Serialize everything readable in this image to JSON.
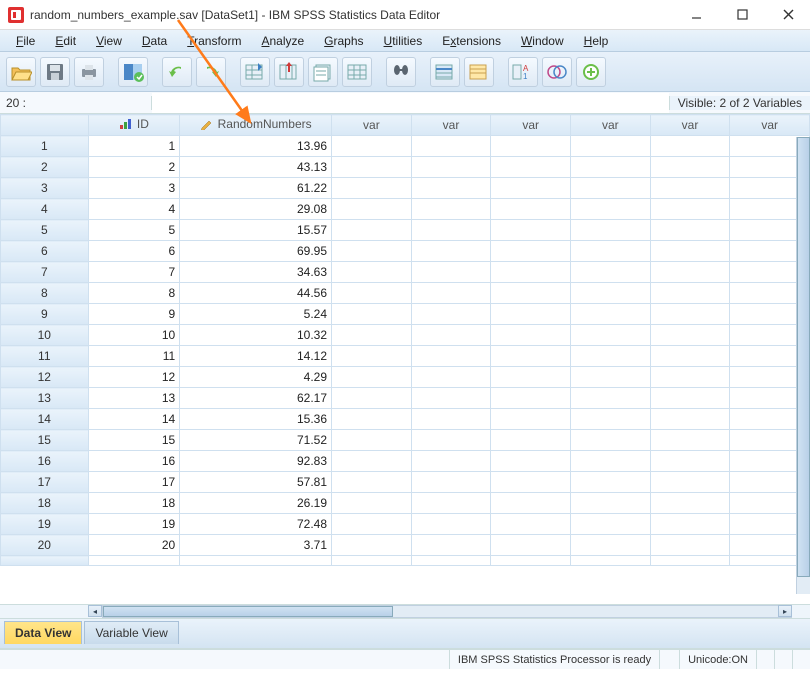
{
  "window": {
    "title": "random_numbers_example.sav [DataSet1] - IBM SPSS Statistics Data Editor"
  },
  "menu": {
    "items": [
      "File",
      "Edit",
      "View",
      "Data",
      "Transform",
      "Analyze",
      "Graphs",
      "Utilities",
      "Extensions",
      "Window",
      "Help"
    ]
  },
  "locbar": {
    "label": "20 :",
    "value": ""
  },
  "visible_label": "Visible: 2 of 2 Variables",
  "columns": {
    "id": "ID",
    "rand": "RandomNumbers",
    "var": "var"
  },
  "rows": [
    {
      "n": "1",
      "id": "1",
      "rand": "13.96"
    },
    {
      "n": "2",
      "id": "2",
      "rand": "43.13"
    },
    {
      "n": "3",
      "id": "3",
      "rand": "61.22"
    },
    {
      "n": "4",
      "id": "4",
      "rand": "29.08"
    },
    {
      "n": "5",
      "id": "5",
      "rand": "15.57"
    },
    {
      "n": "6",
      "id": "6",
      "rand": "69.95"
    },
    {
      "n": "7",
      "id": "7",
      "rand": "34.63"
    },
    {
      "n": "8",
      "id": "8",
      "rand": "44.56"
    },
    {
      "n": "9",
      "id": "9",
      "rand": "5.24"
    },
    {
      "n": "10",
      "id": "10",
      "rand": "10.32"
    },
    {
      "n": "11",
      "id": "11",
      "rand": "14.12"
    },
    {
      "n": "12",
      "id": "12",
      "rand": "4.29"
    },
    {
      "n": "13",
      "id": "13",
      "rand": "62.17"
    },
    {
      "n": "14",
      "id": "14",
      "rand": "15.36"
    },
    {
      "n": "15",
      "id": "15",
      "rand": "71.52"
    },
    {
      "n": "16",
      "id": "16",
      "rand": "92.83"
    },
    {
      "n": "17",
      "id": "17",
      "rand": "57.81"
    },
    {
      "n": "18",
      "id": "18",
      "rand": "26.19"
    },
    {
      "n": "19",
      "id": "19",
      "rand": "72.48"
    },
    {
      "n": "20",
      "id": "20",
      "rand": "3.71"
    }
  ],
  "tabs": {
    "data": "Data View",
    "variable": "Variable View"
  },
  "status": {
    "processor": "IBM SPSS Statistics Processor is ready",
    "unicode": "Unicode:ON"
  },
  "icons": {
    "scale": "scale-icon",
    "pencil": "pencil-icon"
  }
}
